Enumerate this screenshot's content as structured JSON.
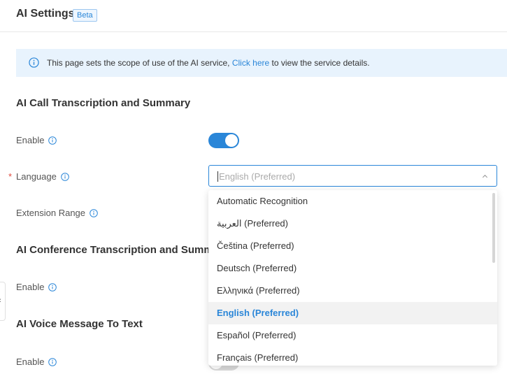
{
  "header": {
    "title": "AI Settings",
    "badge": "Beta"
  },
  "banner": {
    "text_before": "This page sets the scope of use of the AI service, ",
    "link": "Click here",
    "text_after": " to view the service details."
  },
  "call_section": {
    "title": "AI Call Transcription and Summary",
    "enable_label": "Enable",
    "enable_on": true,
    "language_label": "Language",
    "language_value": "English (Preferred)",
    "extension_label": "Extension Range"
  },
  "conference_section": {
    "title": "AI Conference Transcription and Summ",
    "enable_label": "Enable"
  },
  "voice_section": {
    "title": "AI Voice Message To Text",
    "enable_label": "Enable",
    "enable_on": false
  },
  "dropdown": {
    "options": [
      "Automatic Recognition",
      "العربية (Preferred)",
      "Čeština (Preferred)",
      "Deutsch (Preferred)",
      "Ελληνικά (Preferred)",
      "English (Preferred)",
      "Español (Preferred)",
      "Français (Preferred)"
    ],
    "selected": "English (Preferred)"
  },
  "colors": {
    "accent": "#2a86d8",
    "banner_bg": "#e8f3fd",
    "required": "#e0493e"
  },
  "icons": {
    "info": "info-circle-icon",
    "help": "help-circle-icon",
    "chevron": "chevron-up-icon",
    "collapse": "chevron-left-icon"
  }
}
